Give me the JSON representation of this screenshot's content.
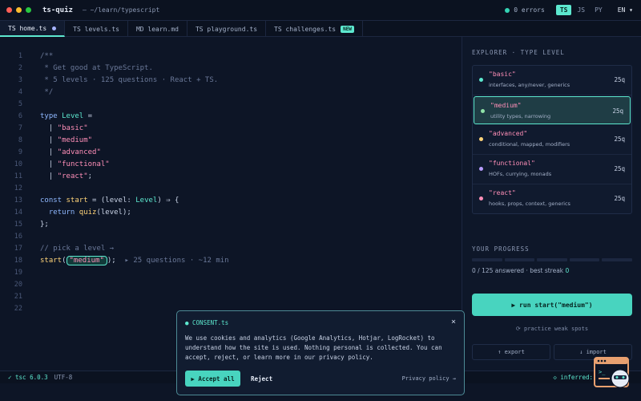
{
  "colors": {
    "accent": "#5de8cf",
    "background": "#0d1526",
    "traffic_red": "#ff5f57",
    "traffic_yellow": "#febc2e",
    "traffic_green": "#28c840"
  },
  "titlebar": {
    "app_name": "ts-quiz",
    "path": "— ~/learn/typescript",
    "errors": "0 errors",
    "langs": [
      "TS",
      "JS",
      "PY"
    ],
    "active_lang": "TS",
    "locale": "EN ▾"
  },
  "tabs": [
    {
      "label": "TS home.ts",
      "active": true,
      "modified": true
    },
    {
      "label": "TS levels.ts"
    },
    {
      "label": "MD learn.md"
    },
    {
      "label": "TS playground.ts"
    },
    {
      "label": "TS challenges.ts",
      "badge": "NEW"
    }
  ],
  "editor": {
    "line_numbers": [
      "1",
      "2",
      "3",
      "4",
      "5",
      "6",
      "7",
      "8",
      "9",
      "10",
      "11",
      "12",
      "13",
      "14",
      "15",
      "16",
      "17",
      "18",
      "19",
      "20",
      "21",
      "22"
    ],
    "lines": {
      "l1": "/**",
      "l2": " * Get good at TypeScript.",
      "l3": " * 5 levels · 125 questions · React + TS.",
      "l4": " */",
      "l6_kw": "type",
      "l6_type": "Level",
      "l6_rest": " =",
      "l7_bar": "  | ",
      "l7_str": "\"basic\"",
      "l8_bar": "  | ",
      "l8_str": "\"medium\"",
      "l9_bar": "  | ",
      "l9_str": "\"advanced\"",
      "l10_bar": "  | ",
      "l10_str": "\"functional\"",
      "l11_bar": "  | ",
      "l11_str": "\"react\"",
      "l11_end": ";",
      "l13_kw": "const",
      "l13_fn": "start",
      "l13_p1": " = (",
      "l13_param": "level",
      "l13_colon": ": ",
      "l13_type": "Level",
      "l13_p2": ") ⇒ {",
      "l14_kw": "  return",
      "l14_fn": "quiz",
      "l14_rest": "(level);",
      "l15": "};",
      "l17": "// pick a level →",
      "l18_fn": "start",
      "l18_open": "(",
      "l18_str": "\"medium\"",
      "l18_close": ");",
      "l18_hint": "  ▸ 25 questions · ~12 min"
    }
  },
  "sidebar": {
    "heading": "EXPLORER · TYPE LEVEL",
    "levels": [
      {
        "name": "\"basic\"",
        "desc": "interfaces, any/never, generics",
        "count": "25q",
        "dot": "#5de8cf"
      },
      {
        "name": "\"medium\"",
        "desc": "utility types, narrowing",
        "count": "25q",
        "dot": "#8fe3a8"
      },
      {
        "name": "\"advanced\"",
        "desc": "conditional, mapped, modifiers",
        "count": "25q",
        "dot": "#ffd479"
      },
      {
        "name": "\"functional\"",
        "desc": "HOFs, currying, monads",
        "count": "25q",
        "dot": "#b79cff"
      },
      {
        "name": "\"react\"",
        "desc": "hooks, props, context, generics",
        "count": "25q",
        "dot": "#ff8fb8"
      }
    ],
    "selected_level": "\"medium\"",
    "progress_heading": "YOUR PROGRESS",
    "progress_fraction": 0,
    "progress_prefix": "0 / 125 answered · best streak ",
    "progress_streak": "0",
    "run_button": "▶ run start(\"medium\")",
    "weak_spots": "⟳ practice weak spots",
    "export": "↑ export",
    "import": "↓ import"
  },
  "statusbar": {
    "tsc": "✓ tsc 6.0.3",
    "encoding": "UTF-8",
    "inferred": "◇ inferred:"
  },
  "consent": {
    "title": "● CONSENT.ts",
    "close": "×",
    "body": "We use cookies and analytics (Google Analytics, Hotjar, LogRocket) to understand how the site is used. Nothing personal is collected. You can accept, reject, or learn more in our privacy policy.",
    "accept": "▶ Accept all",
    "reject": "Reject",
    "privacy": "Privacy policy →"
  }
}
